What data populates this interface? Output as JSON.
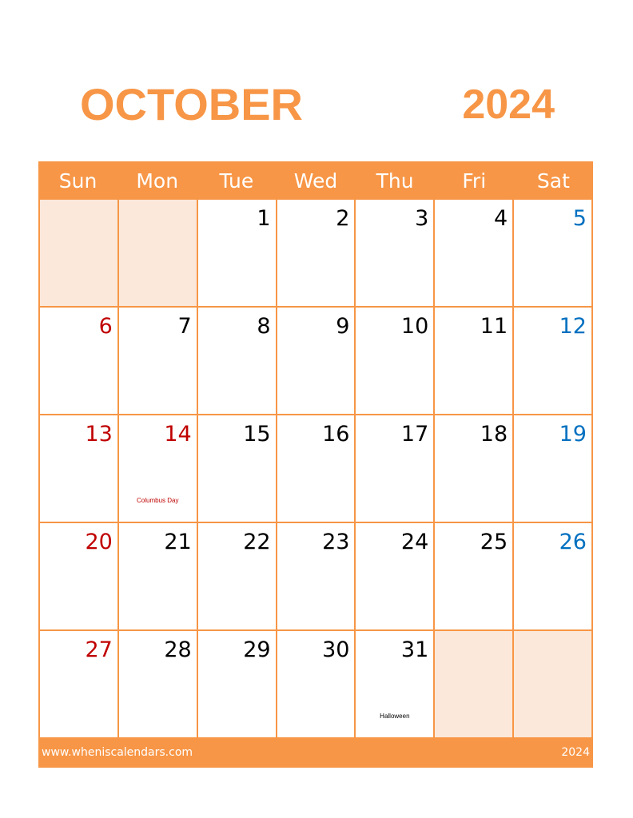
{
  "title": {
    "month": "OCTOBER",
    "year": "2024"
  },
  "weekdays": [
    "Sun",
    "Mon",
    "Tue",
    "Wed",
    "Thu",
    "Fri",
    "Sat"
  ],
  "colors": {
    "accent": "#f79646",
    "empty_cell": "#fbe8da",
    "sunday": "#c00000",
    "saturday": "#0070c0",
    "holiday": "#c00000"
  },
  "weeks": [
    [
      {
        "day": ""
      },
      {
        "day": ""
      },
      {
        "day": "1"
      },
      {
        "day": "2"
      },
      {
        "day": "3"
      },
      {
        "day": "4"
      },
      {
        "day": "5"
      }
    ],
    [
      {
        "day": "6"
      },
      {
        "day": "7"
      },
      {
        "day": "8"
      },
      {
        "day": "9"
      },
      {
        "day": "10"
      },
      {
        "day": "11"
      },
      {
        "day": "12"
      }
    ],
    [
      {
        "day": "13"
      },
      {
        "day": "14",
        "note": "Columbus Day",
        "holiday": true
      },
      {
        "day": "15"
      },
      {
        "day": "16"
      },
      {
        "day": "17"
      },
      {
        "day": "18"
      },
      {
        "day": "19"
      }
    ],
    [
      {
        "day": "20"
      },
      {
        "day": "21"
      },
      {
        "day": "22"
      },
      {
        "day": "23"
      },
      {
        "day": "24"
      },
      {
        "day": "25"
      },
      {
        "day": "26"
      }
    ],
    [
      {
        "day": "27"
      },
      {
        "day": "28"
      },
      {
        "day": "29"
      },
      {
        "day": "30"
      },
      {
        "day": "31",
        "note": "Halloween"
      },
      {
        "day": ""
      },
      {
        "day": ""
      }
    ]
  ],
  "footer": {
    "website": "www.wheniscalendars.com",
    "year": "2024"
  }
}
